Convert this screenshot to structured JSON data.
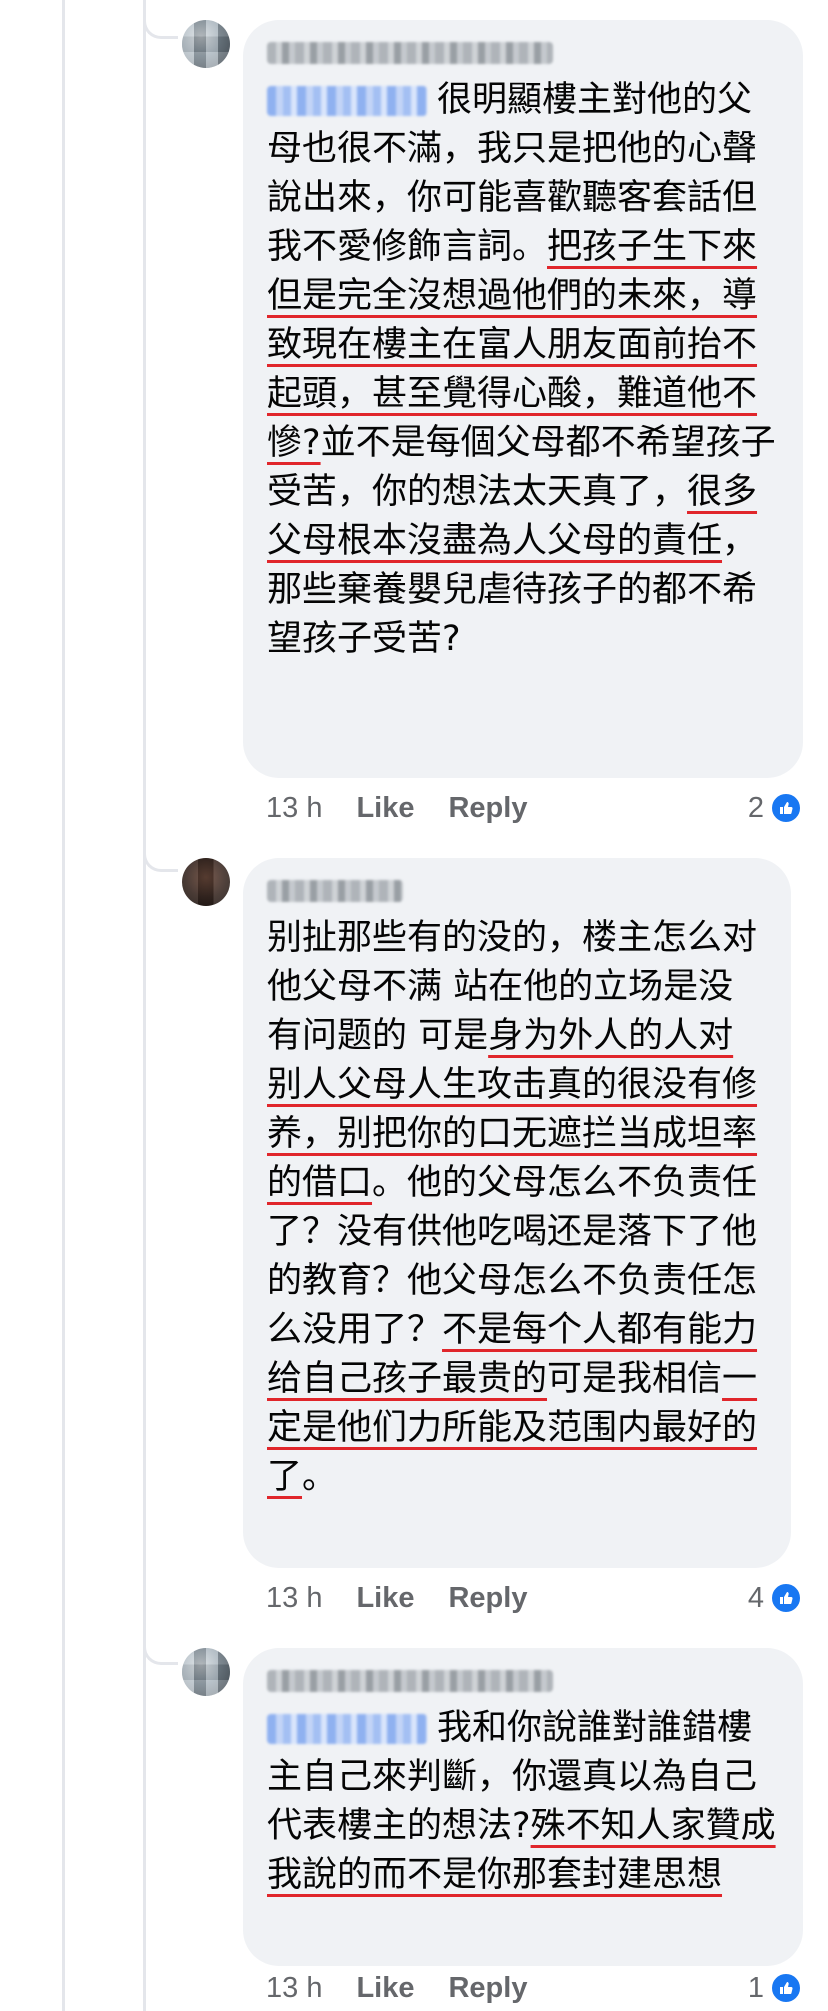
{
  "comments": [
    {
      "author": "",
      "mention": "",
      "time": "13 h",
      "like_label": "Like",
      "reply_label": "Reply",
      "reaction_count": "2",
      "reaction_icon": "thumbs-up-icon",
      "segments": [
        "很明顯樓主對他的父母也很不滿，我只是把他的心聲說出來，你可能喜歡聽客套話但我不愛修飾言詞。",
        "把孩子生下來但是完全沒想過他們的未來，導致現在樓主在富人朋友面前抬不起頭，甚至覺得心酸，難道他不慘?",
        "並不是每個父母都不希望孩子受苦，你的想法太天真了，",
        "很多父母根本沒盡為人父母的責任",
        "，那些棄養嬰兒虐待孩子的都不希望孩子受苦?"
      ]
    },
    {
      "author": "",
      "time": "13 h",
      "like_label": "Like",
      "reply_label": "Reply",
      "reaction_count": "4",
      "reaction_icon": "thumbs-up-icon",
      "segments": [
        "别扯那些有的没的，楼主怎么对他父母不满 站在他的立场是没有问题的 可是",
        "身为外人的人对别人父母人生攻击真的很没有修养，别把你的口无遮拦当成坦率的借口",
        "。他的父母怎么不负责任了？没有供他吃喝还是落下了他的教育？他父母怎么不负责任怎么没用了？",
        "不是每个人都有能力给自己孩子最贵的",
        "可是我相信",
        "一定是他们力所能及范围内最好的了",
        "。"
      ]
    },
    {
      "author": "",
      "mention": "",
      "time": "13 h",
      "like_label": "Like",
      "reply_label": "Reply",
      "reaction_count": "1",
      "reaction_icon": "thumbs-up-icon",
      "segments": [
        "我和你說誰對誰錯樓主自己來判斷，你還真以為自己代表樓主的想法?",
        "殊不知人家贊成我說的而不是你那套封建思想"
      ]
    }
  ],
  "colors": {
    "bubble_bg": "#f0f2f5",
    "meta_text": "#65676b",
    "underline": "#e0262b",
    "like_blue": "#1877f2",
    "thread_line": "#e4e6eb"
  }
}
